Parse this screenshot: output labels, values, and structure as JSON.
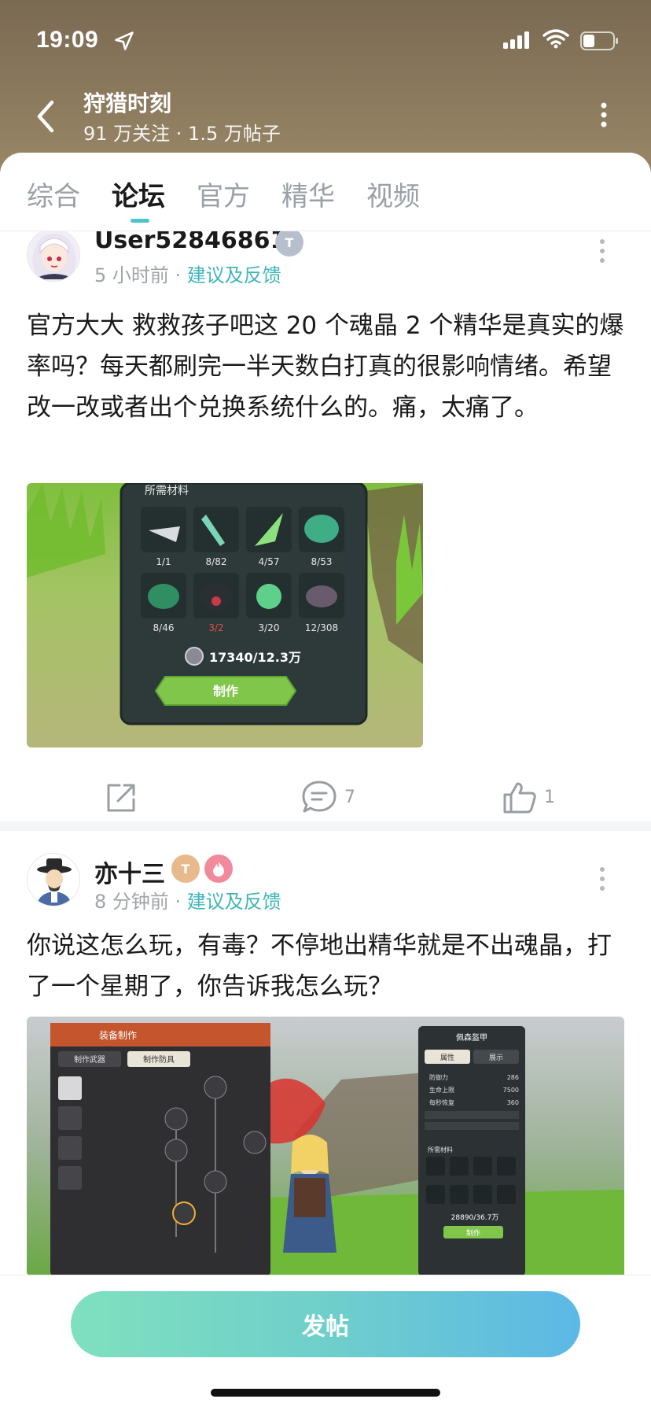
{
  "status_bar": {
    "time": "19:09"
  },
  "header": {
    "title": "狩猎时刻",
    "subtitle": "91 万关注 · 1.5 万帖子"
  },
  "tabs": [
    {
      "label": "综合",
      "active": false
    },
    {
      "label": "论坛",
      "active": true
    },
    {
      "label": "官方",
      "active": false
    },
    {
      "label": "精华",
      "active": false
    },
    {
      "label": "视频",
      "active": false
    }
  ],
  "posts": [
    {
      "username": "User52846861",
      "time": "5 小时前",
      "category": "建议及反馈",
      "content": "官方大大  救救孩子吧这 20 个魂晶 2 个精华是真实的爆率吗？每天都刷完一半天数白打真的很影响情绪。希望改一改或者出个兑换系统什么的。痛，太痛了。",
      "image": {
        "panel_title": "所需材料",
        "materials": [
          "1/1",
          "8/82",
          "4/57",
          "8/53",
          "8/46",
          "3/2",
          "3/20",
          "12/308"
        ],
        "cost": "17340/12.3万",
        "craft_label": "制作"
      },
      "comments": "7",
      "likes": "1"
    },
    {
      "username": "亦十三",
      "time": "8 分钟前",
      "category": "建议及反馈",
      "content": "你说这怎么玩，有毒？不停地出精华就是不出魂晶，打了一个星期了，你告诉我怎么玩？",
      "image": {
        "left_panel_title": "装备制作",
        "tab_weapon": "制作武器",
        "tab_armor": "制作防具",
        "right_panel_title": "佩森盔甲",
        "tab_attr": "属性",
        "tab_show": "展示",
        "stats": [
          {
            "label": "防御力",
            "value": "286"
          },
          {
            "label": "生命上限",
            "value": "7500"
          },
          {
            "label": "每秒恢复",
            "value": "360"
          }
        ],
        "materials_title": "所需材料",
        "cost": "28890/36.7万",
        "craft_label": "制作"
      }
    }
  ],
  "bottom": {
    "post_button": "发帖"
  },
  "colors": {
    "accent": "#3fb6ba",
    "header_bg": "#8c7a5e",
    "button_gradient_start": "#7fe0bf",
    "button_gradient_end": "#5cb8e6"
  }
}
